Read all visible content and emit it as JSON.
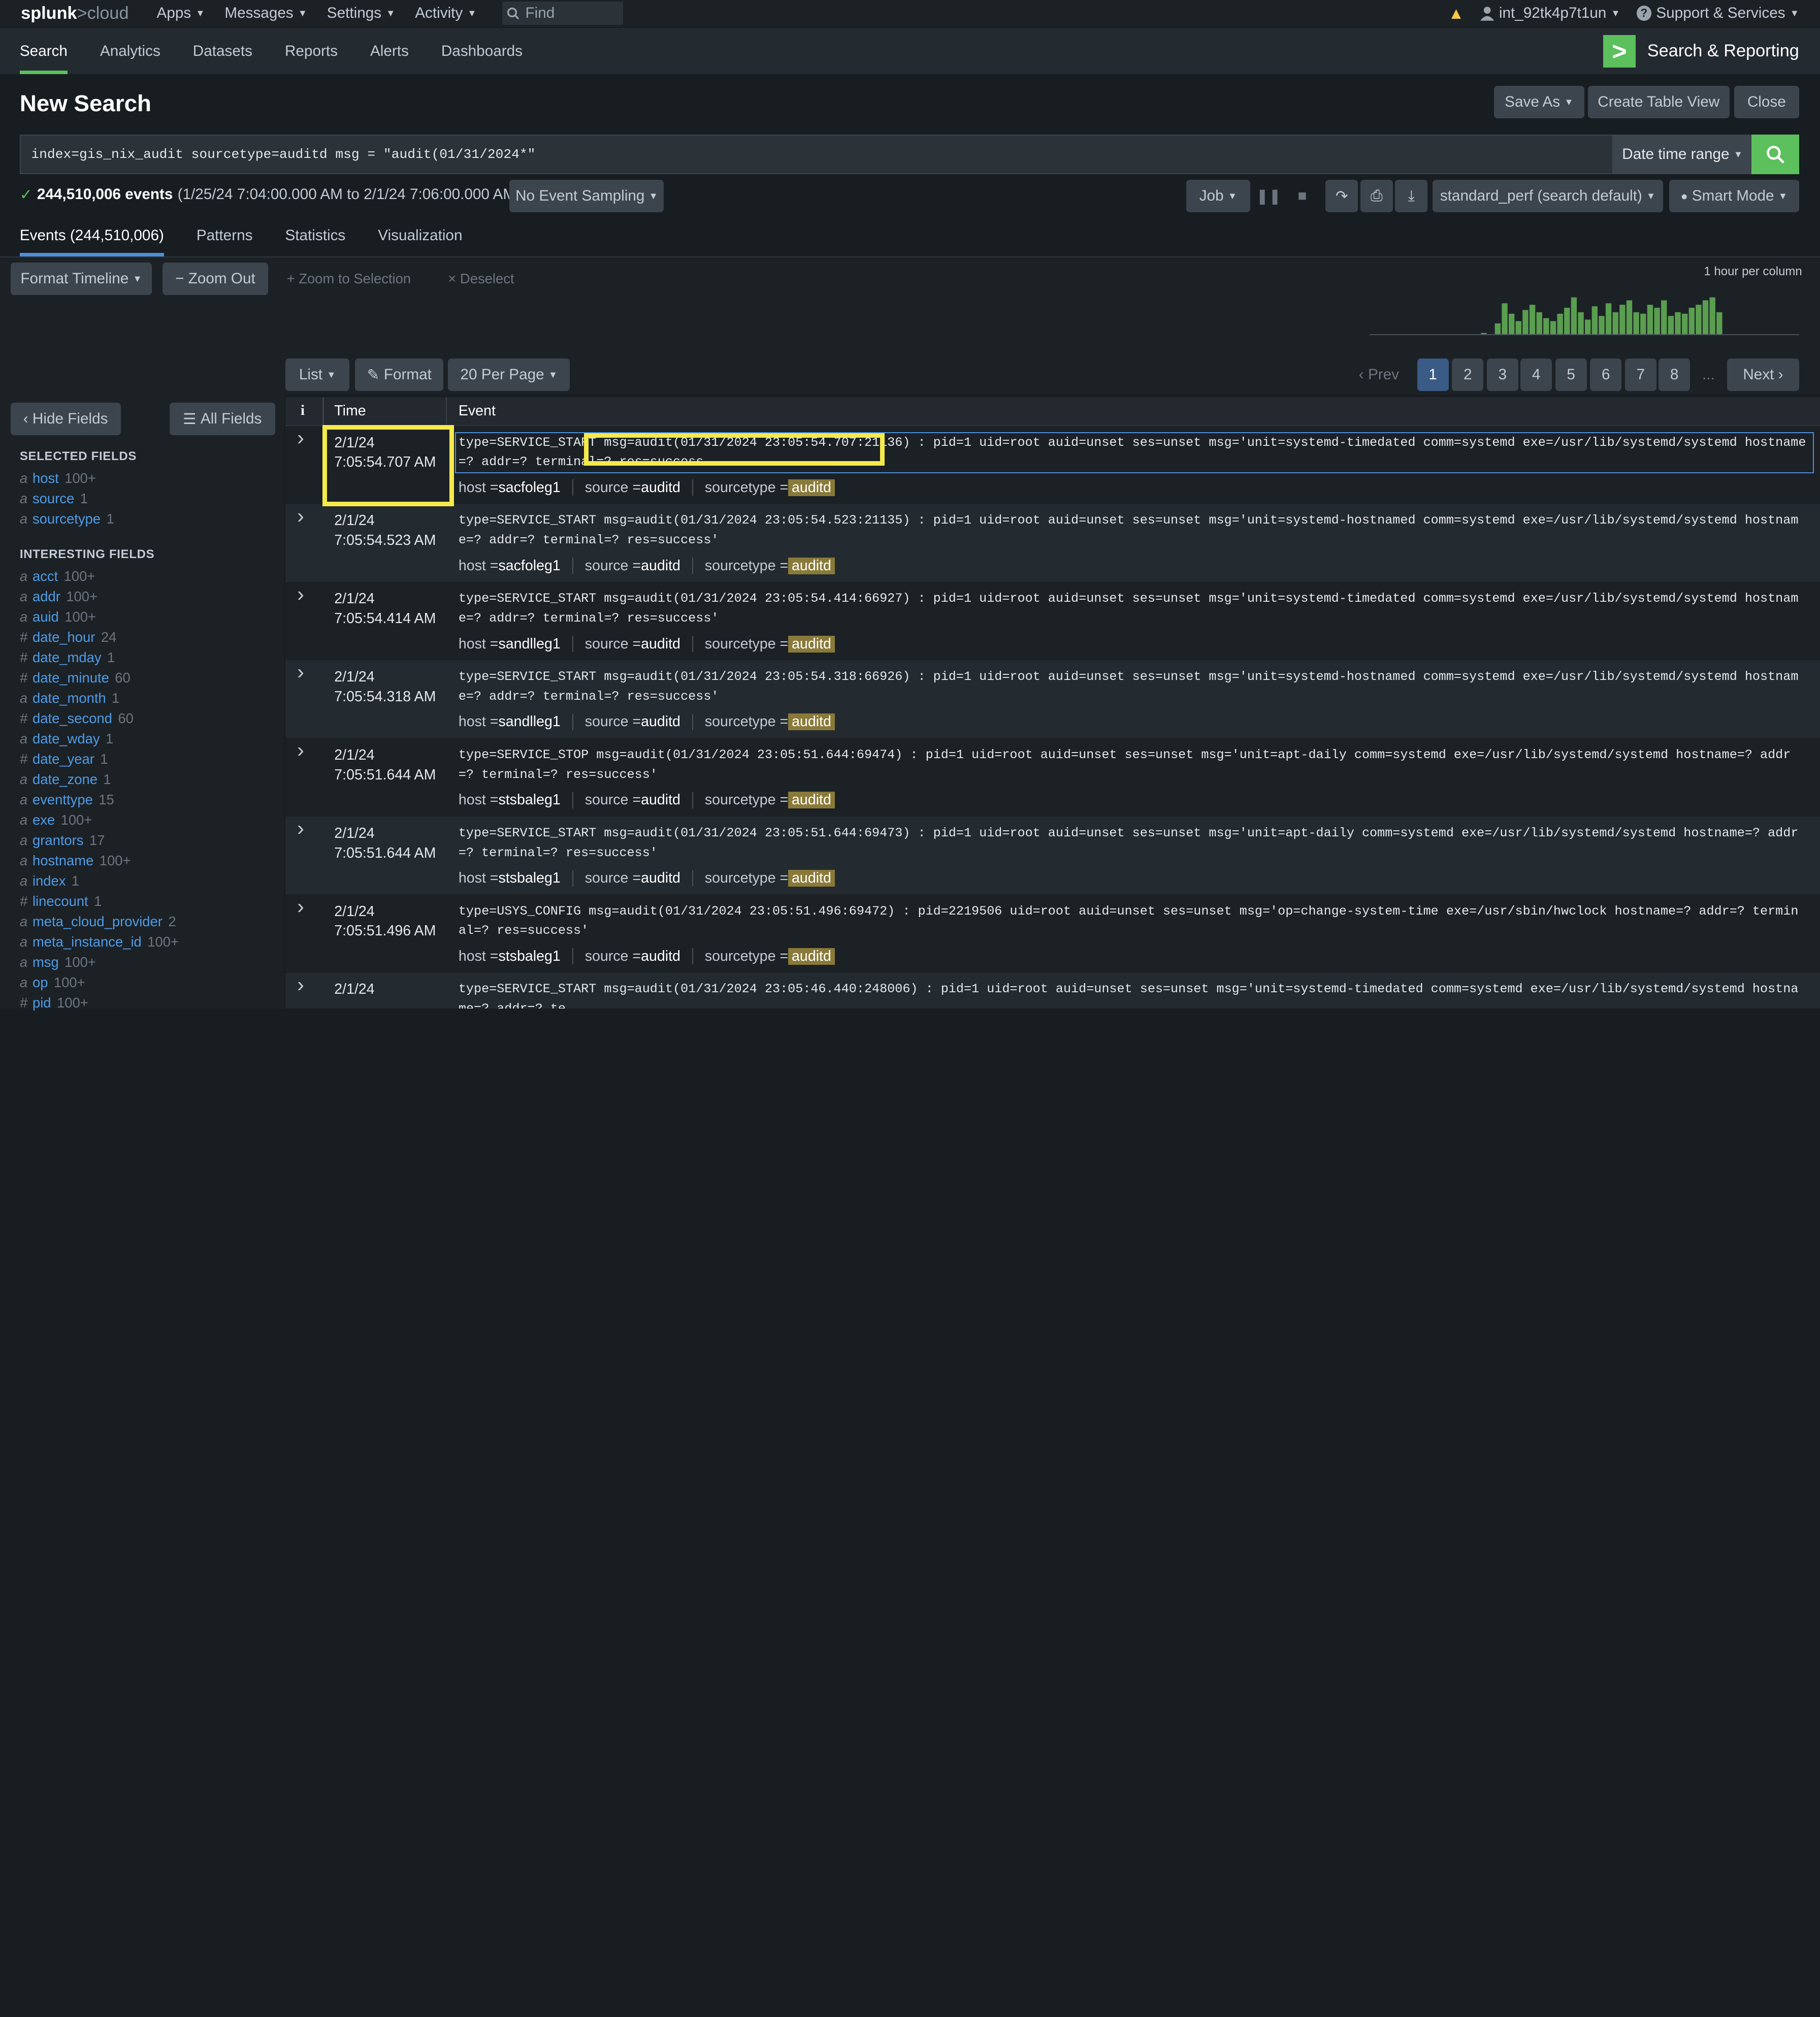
{
  "topbar": {
    "logo_main": "splunk",
    "logo_gt": ">",
    "logo_cloud": "cloud",
    "menus": [
      "Apps",
      "Messages",
      "Settings",
      "Activity"
    ],
    "find_placeholder": "Find",
    "user": "int_92tk4p7t1un",
    "support": "Support & Services"
  },
  "appbar": {
    "nav": [
      "Search",
      "Analytics",
      "Datasets",
      "Reports",
      "Alerts",
      "Dashboards"
    ],
    "app_title": "Search & Reporting"
  },
  "page": {
    "title": "New Search",
    "save_as": "Save As",
    "create_table_view": "Create Table View",
    "close": "Close"
  },
  "search": {
    "query": "index=gis_nix_audit sourcetype=auditd msg = \"audit(01/31/2024*\"",
    "date_range": "Date time range"
  },
  "status": {
    "count": "244,510,006 events",
    "range": "(1/25/24 7:04:00.000 AM to 2/1/24 7:06:00.000 AM)",
    "sampling": "No Event Sampling",
    "job": "Job",
    "perf": "standard_perf (search default)",
    "mode": "Smart Mode"
  },
  "tabs": [
    "Events (244,510,006)",
    "Patterns",
    "Statistics",
    "Visualization"
  ],
  "timeline": {
    "format": "Format Timeline",
    "zoom_out": "Zoom Out",
    "zoom_sel": "Zoom to Selection",
    "deselect": "Deselect",
    "per_column": "1 hour per column",
    "histogram": [
      0,
      0,
      0,
      0,
      0,
      0,
      0,
      0,
      0,
      0,
      0,
      0,
      0,
      0,
      0,
      0,
      2,
      0,
      15,
      42,
      28,
      18,
      33,
      40,
      30,
      22,
      18,
      28,
      36,
      50,
      30,
      20,
      38,
      25,
      42,
      30,
      40,
      46,
      30,
      28,
      40,
      36,
      46,
      25,
      30,
      28,
      36,
      40,
      46,
      50,
      30,
      0,
      0,
      0,
      0,
      0,
      0,
      0,
      0,
      0,
      0,
      0
    ]
  },
  "pager": {
    "list": "List",
    "format": "Format",
    "per_page": "20 Per Page",
    "prev": "Prev",
    "pages": [
      "1",
      "2",
      "3",
      "4",
      "5",
      "6",
      "7",
      "8"
    ],
    "ellipsis": "...",
    "next": "Next"
  },
  "fields": {
    "hide": "Hide Fields",
    "all": "All Fields",
    "selected_heading": "SELECTED FIELDS",
    "selected": [
      {
        "type": "a",
        "name": "host",
        "count": "100+"
      },
      {
        "type": "a",
        "name": "source",
        "count": "1"
      },
      {
        "type": "a",
        "name": "sourcetype",
        "count": "1"
      }
    ],
    "interesting_heading": "INTERESTING FIELDS",
    "interesting": [
      {
        "type": "a",
        "name": "acct",
        "count": "100+"
      },
      {
        "type": "a",
        "name": "addr",
        "count": "100+"
      },
      {
        "type": "a",
        "name": "auid",
        "count": "100+"
      },
      {
        "type": "#",
        "name": "date_hour",
        "count": "24"
      },
      {
        "type": "#",
        "name": "date_mday",
        "count": "1"
      },
      {
        "type": "#",
        "name": "date_minute",
        "count": "60"
      },
      {
        "type": "a",
        "name": "date_month",
        "count": "1"
      },
      {
        "type": "#",
        "name": "date_second",
        "count": "60"
      },
      {
        "type": "a",
        "name": "date_wday",
        "count": "1"
      },
      {
        "type": "#",
        "name": "date_year",
        "count": "1"
      },
      {
        "type": "a",
        "name": "date_zone",
        "count": "1"
      },
      {
        "type": "a",
        "name": "eventtype",
        "count": "15"
      },
      {
        "type": "a",
        "name": "exe",
        "count": "100+"
      },
      {
        "type": "a",
        "name": "grantors",
        "count": "17"
      },
      {
        "type": "a",
        "name": "hostname",
        "count": "100+"
      },
      {
        "type": "a",
        "name": "index",
        "count": "1"
      },
      {
        "type": "#",
        "name": "linecount",
        "count": "1"
      },
      {
        "type": "a",
        "name": "meta_cloud_provider",
        "count": "2"
      },
      {
        "type": "a",
        "name": "meta_instance_id",
        "count": "100+"
      },
      {
        "type": "a",
        "name": "msg",
        "count": "100+"
      },
      {
        "type": "a",
        "name": "op",
        "count": "100+"
      },
      {
        "type": "#",
        "name": "pid",
        "count": "100+"
      }
    ]
  },
  "table": {
    "col_i": "i",
    "col_time": "Time",
    "col_event": "Event",
    "meta_labels": {
      "host": "host",
      "source": "source",
      "sourcetype": "sourcetype"
    },
    "rows": [
      {
        "date": "2/1/24",
        "time": "7:05:54.707 AM",
        "event": "type=SERVICE_START msg=audit(01/31/2024 23:05:54.707:21136) : pid=1 uid=root auid=unset ses=unset msg='unit=systemd-timedated comm=systemd exe=/usr/lib/systemd/systemd hostname=? addr=? terminal=? res=success",
        "host": "sacfoleg1",
        "source": "auditd",
        "sourcetype": "auditd"
      },
      {
        "date": "2/1/24",
        "time": "7:05:54.523 AM",
        "event": "type=SERVICE_START msg=audit(01/31/2024 23:05:54.523:21135) : pid=1 uid=root auid=unset ses=unset msg='unit=systemd-hostnamed comm=systemd exe=/usr/lib/systemd/systemd hostname=? addr=? terminal=? res=success'",
        "host": "sacfoleg1",
        "source": "auditd",
        "sourcetype": "auditd"
      },
      {
        "date": "2/1/24",
        "time": "7:05:54.414 AM",
        "event": "type=SERVICE_START msg=audit(01/31/2024 23:05:54.414:66927) : pid=1 uid=root auid=unset ses=unset msg='unit=systemd-timedated comm=systemd exe=/usr/lib/systemd/systemd hostname=? addr=? terminal=? res=success'",
        "host": "sandlleg1",
        "source": "auditd",
        "sourcetype": "auditd"
      },
      {
        "date": "2/1/24",
        "time": "7:05:54.318 AM",
        "event": "type=SERVICE_START msg=audit(01/31/2024 23:05:54.318:66926) : pid=1 uid=root auid=unset ses=unset msg='unit=systemd-hostnamed comm=systemd exe=/usr/lib/systemd/systemd hostname=? addr=? terminal=? res=success'",
        "host": "sandlleg1",
        "source": "auditd",
        "sourcetype": "auditd"
      },
      {
        "date": "2/1/24",
        "time": "7:05:51.644 AM",
        "event": "type=SERVICE_STOP msg=audit(01/31/2024 23:05:51.644:69474) : pid=1 uid=root auid=unset ses=unset msg='unit=apt-daily comm=systemd exe=/usr/lib/systemd/systemd hostname=? addr=? terminal=? res=success'",
        "host": "stsbaleg1",
        "source": "auditd",
        "sourcetype": "auditd"
      },
      {
        "date": "2/1/24",
        "time": "7:05:51.644 AM",
        "event": "type=SERVICE_START msg=audit(01/31/2024 23:05:51.644:69473) : pid=1 uid=root auid=unset ses=unset msg='unit=apt-daily comm=systemd exe=/usr/lib/systemd/systemd hostname=? addr=? terminal=? res=success'",
        "host": "stsbaleg1",
        "source": "auditd",
        "sourcetype": "auditd"
      },
      {
        "date": "2/1/24",
        "time": "7:05:51.496 AM",
        "event": "type=USYS_CONFIG msg=audit(01/31/2024 23:05:51.496:69472) : pid=2219506 uid=root auid=unset ses=unset msg='op=change-system-time exe=/usr/sbin/hwclock hostname=? addr=? terminal=? res=success'",
        "host": "stsbaleg1",
        "source": "auditd",
        "sourcetype": "auditd"
      },
      {
        "date": "2/1/24",
        "time": "",
        "event": "type=SERVICE_START msg=audit(01/31/2024 23:05:46.440:248006) : pid=1 uid=root auid=unset ses=unset msg='unit=systemd-timedated comm=systemd exe=/usr/lib/systemd/systemd hostname=? addr=? te",
        "host": "",
        "source": "",
        "sourcetype": ""
      }
    ]
  },
  "colors": {
    "accent_green": "#5cc05c",
    "highlight_yellow": "#f5ea4c",
    "link_blue": "#4e9ce6"
  }
}
